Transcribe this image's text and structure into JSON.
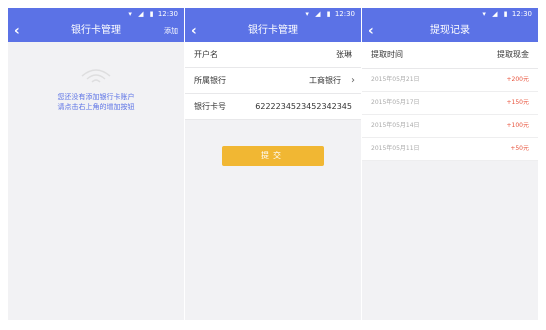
{
  "status_time": "12:30",
  "status_icons": "▾ ◢ ▮",
  "accent": "#5b72e6",
  "screen1": {
    "title": "银行卡管理",
    "action": "添加",
    "empty_line1": "您还没有添加银行卡账户",
    "empty_line2": "请点击右上角的增加按钮"
  },
  "screen2": {
    "title": "银行卡管理",
    "rows": [
      {
        "label": "开户名",
        "value": "张琳"
      },
      {
        "label": "所属银行",
        "value": "工商银行"
      },
      {
        "label": "银行卡号",
        "value": "6222234523452342345"
      }
    ],
    "submit": "提交"
  },
  "screen3": {
    "title": "提现记录",
    "col_time": "提取时间",
    "col_amount": "提取现金",
    "records": [
      {
        "date": "2015年05月21日",
        "amount": "+200元"
      },
      {
        "date": "2015年05月17日",
        "amount": "+150元"
      },
      {
        "date": "2015年05月14日",
        "amount": "+100元"
      },
      {
        "date": "2015年05月11日",
        "amount": "+50元"
      }
    ]
  }
}
